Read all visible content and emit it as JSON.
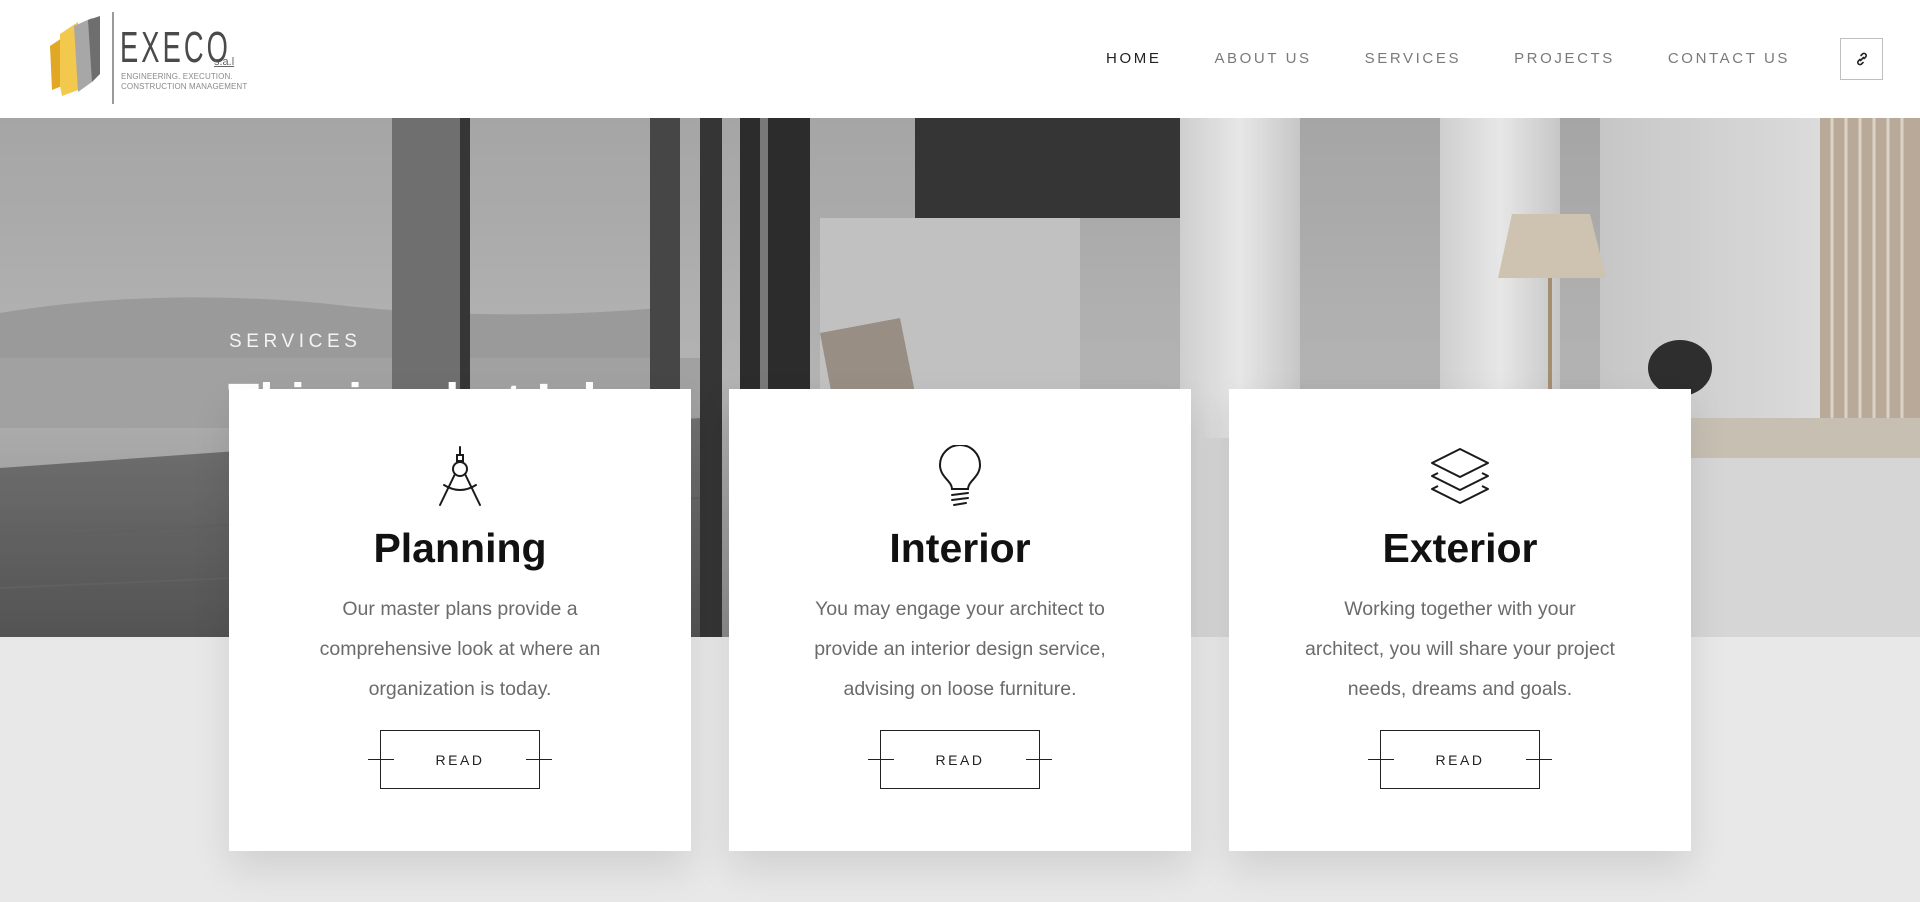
{
  "brand": {
    "name": "EXECO",
    "suffix": "s.a.l",
    "tagline_1": "ENGINEERING. EXECUTION.",
    "tagline_2": "CONSTRUCTION MANAGEMENT",
    "colors": {
      "gold": "#e0a825",
      "gray": "#8c8c8c",
      "dark": "#555555"
    }
  },
  "nav": {
    "items": [
      {
        "label": "HOME",
        "active": true
      },
      {
        "label": "ABOUT US",
        "active": false
      },
      {
        "label": "SERVICES",
        "active": false
      },
      {
        "label": "PROJECTS",
        "active": false
      },
      {
        "label": "CONTACT US",
        "active": false
      }
    ],
    "link_icon": "link-icon"
  },
  "hero": {
    "kicker": "SERVICES",
    "title": "This is what I do."
  },
  "cards": [
    {
      "icon": "compass-icon",
      "title": "Planning",
      "text": "Our master plans provide a comprehensive look at where an organization is today.",
      "button": "READ"
    },
    {
      "icon": "lightbulb-icon",
      "title": "Interior",
      "text": "You may engage your architect to provide an interior design service, advising on loose furniture.",
      "button": "READ"
    },
    {
      "icon": "layers-icon",
      "title": "Exterior",
      "text": "Working together with your architect, you will share your project needs, dreams and goals.",
      "button": "READ"
    }
  ]
}
